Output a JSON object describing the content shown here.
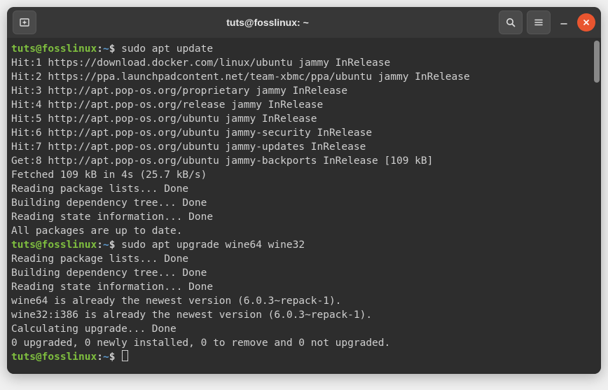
{
  "titlebar": {
    "title": "tuts@fosslinux: ~"
  },
  "prompt": {
    "user_host": "tuts@fosslinux",
    "sep": ":",
    "path": "~",
    "symbol": "$"
  },
  "blocks": [
    {
      "command": "sudo apt update",
      "output": [
        "Hit:1 https://download.docker.com/linux/ubuntu jammy InRelease",
        "Hit:2 https://ppa.launchpadcontent.net/team-xbmc/ppa/ubuntu jammy InRelease",
        "Hit:3 http://apt.pop-os.org/proprietary jammy InRelease",
        "Hit:4 http://apt.pop-os.org/release jammy InRelease",
        "Hit:5 http://apt.pop-os.org/ubuntu jammy InRelease",
        "Hit:6 http://apt.pop-os.org/ubuntu jammy-security InRelease",
        "Hit:7 http://apt.pop-os.org/ubuntu jammy-updates InRelease",
        "Get:8 http://apt.pop-os.org/ubuntu jammy-backports InRelease [109 kB]",
        "Fetched 109 kB in 4s (25.7 kB/s)",
        "Reading package lists... Done",
        "Building dependency tree... Done",
        "Reading state information... Done",
        "All packages are up to date."
      ]
    },
    {
      "command": "sudo apt upgrade wine64 wine32",
      "output": [
        "Reading package lists... Done",
        "Building dependency tree... Done",
        "Reading state information... Done",
        "wine64 is already the newest version (6.0.3~repack-1).",
        "wine32:i386 is already the newest version (6.0.3~repack-1).",
        "Calculating upgrade... Done",
        "0 upgraded, 0 newly installed, 0 to remove and 0 not upgraded."
      ]
    }
  ]
}
